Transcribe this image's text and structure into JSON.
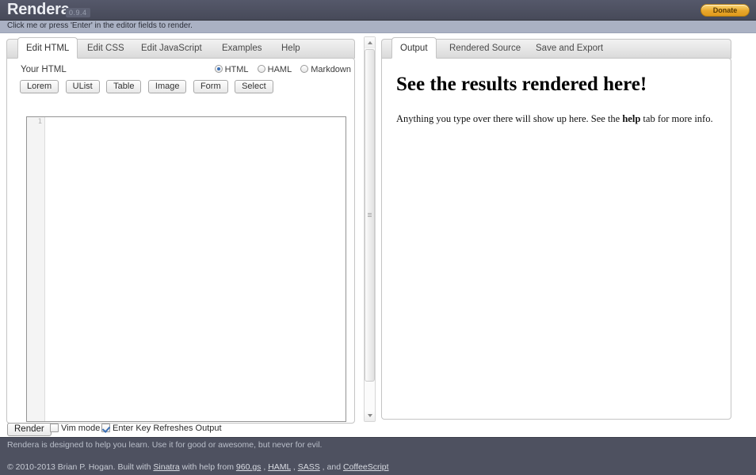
{
  "header": {
    "app_title": "Rendera",
    "version": "0.9.4",
    "donate_label": "Donate",
    "subheader_text": "Click me or press 'Enter' in the editor fields to render.",
    "colors": {
      "header_bg": "#4e5160",
      "subheader_bg": "#aab1c3",
      "donate_bg": "#e8a72c",
      "accent": "#3a6fb5"
    }
  },
  "left_panel": {
    "tabs": [
      {
        "label": "Edit HTML",
        "active": true
      },
      {
        "label": "Edit CSS",
        "active": false
      },
      {
        "label": "Edit JavaScript",
        "active": false
      },
      {
        "label": "Examples",
        "active": false
      },
      {
        "label": "Help",
        "active": false
      }
    ],
    "editor_label": "Your HTML",
    "formats": [
      {
        "label": "HTML",
        "selected": true
      },
      {
        "label": "HAML",
        "selected": false
      },
      {
        "label": "Markdown",
        "selected": false
      }
    ],
    "snippet_buttons": [
      "Lorem",
      "UList",
      "Table",
      "Image",
      "Form",
      "Select"
    ],
    "editor": {
      "line_number": "1",
      "content": "",
      "placeholder": ""
    }
  },
  "right_panel": {
    "tabs": [
      {
        "label": "Output",
        "active": true
      },
      {
        "label": "Rendered Source",
        "active": false
      },
      {
        "label": "Save and Export",
        "active": false
      }
    ],
    "output": {
      "heading": "See the results rendered here!",
      "paragraph_before": "Anything you type over there will show up here. See the ",
      "paragraph_bold": "help",
      "paragraph_after": " tab for more info."
    }
  },
  "bottom_toolbar": {
    "render_label": "Render",
    "vim_mode_label": "Vim mode",
    "vim_mode_checked": false,
    "enter_key_label": "Enter Key Refreshes Output",
    "enter_key_checked": true
  },
  "footer": {
    "tagline": "Rendera is designed to help you learn. Use it for good or awesome, but never for evil.",
    "credit_prefix": "© 2010-2013 Brian P. Hogan. Built with ",
    "link_sinatra": "Sinatra",
    "credit_mid1": " with help from ",
    "link_960gs": "960.gs",
    "credit_sep1": " , ",
    "link_haml": "HAML",
    "credit_sep2": " , ",
    "link_sass": "SASS",
    "credit_sep3": " , and ",
    "link_coffeescript": "CoffeeScript"
  },
  "icons": {
    "scroll_up": "scroll-up-arrow-icon",
    "scroll_down": "scroll-down-arrow-icon",
    "grip": "scrollbar-grip-icon"
  }
}
